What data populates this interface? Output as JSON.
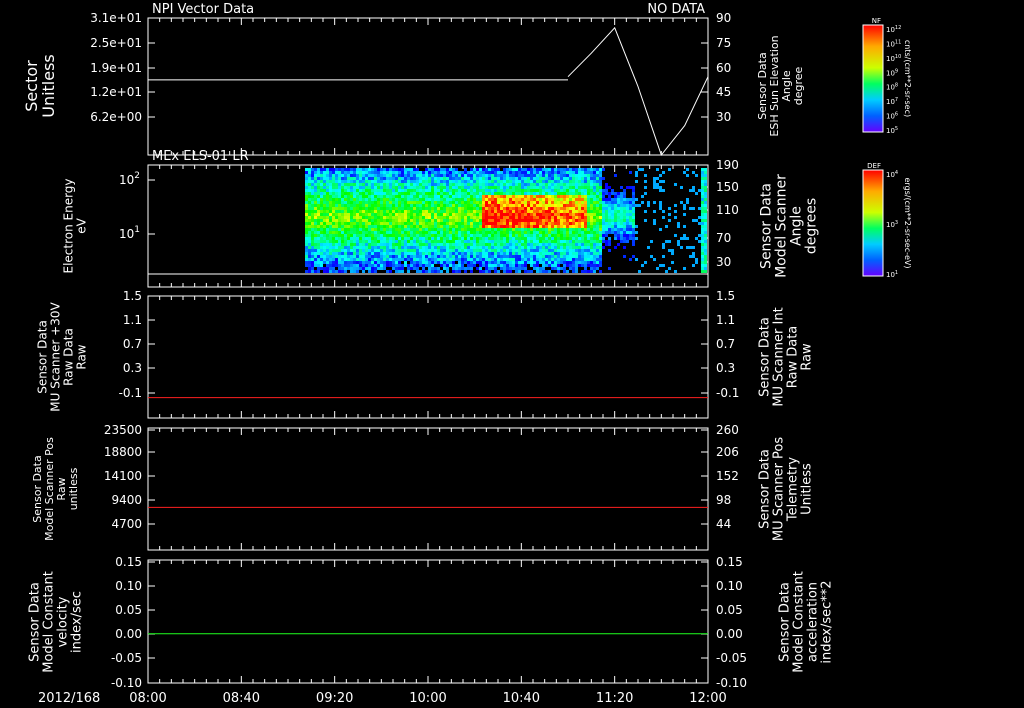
{
  "header": {
    "dataset_title": "NPI Vector Data",
    "status": "NO DATA"
  },
  "time_axis": {
    "date": "2012/168",
    "ticks": [
      "08:00",
      "08:40",
      "09:20",
      "10:00",
      "10:40",
      "11:20",
      "12:00"
    ]
  },
  "panels": [
    {
      "left_label": [
        "Sector",
        "Unitless"
      ],
      "left_ticks": [
        "3.1e+01",
        "2.5e+01",
        "1.9e+01",
        "1.2e+01",
        "6.2e+00"
      ],
      "right_label": [
        "Sensor Data",
        "ESH Sun Elevation",
        "Angle",
        "degree"
      ],
      "right_ticks": [
        "90",
        "75",
        "60",
        "45",
        "30"
      ]
    },
    {
      "title": "MEx ELS-01 LR",
      "left_label": [
        "Electron Energy",
        "eV"
      ],
      "left_ticks": [
        "10",
        "10"
      ],
      "left_tick_exponents": [
        "2",
        "1"
      ],
      "right_label": [
        "Sensor Data",
        "Model Scanner",
        "Angle",
        "degrees"
      ],
      "right_ticks": [
        "190",
        "150",
        "110",
        "70",
        "30"
      ]
    },
    {
      "left_label": [
        "Sensor Data",
        "MU Scanner +30V",
        "Raw Data",
        "Raw"
      ],
      "left_ticks": [
        "1.5",
        "1.1",
        "0.7",
        "0.3",
        "-0.1"
      ],
      "right_label": [
        "Sensor Data",
        "MU Scanner Int",
        "Raw Data",
        "Raw"
      ],
      "right_ticks": [
        "1.5",
        "1.1",
        "0.7",
        "0.3",
        "-0.1"
      ]
    },
    {
      "left_label": [
        "Sensor Data",
        "Model Scanner Pos",
        "Raw",
        "unitless"
      ],
      "left_ticks": [
        "23500",
        "18800",
        "14100",
        "9400",
        "4700"
      ],
      "right_label": [
        "Sensor Data",
        "MU Scanner Pos",
        "Telemetry",
        "Unitless"
      ],
      "right_ticks": [
        "260",
        "206",
        "152",
        "98",
        "44"
      ]
    },
    {
      "left_label": [
        "Sensor Data",
        "Model Constant",
        "velocity",
        "index/sec"
      ],
      "left_ticks": [
        "0.15",
        "0.10",
        "0.05",
        "0.00",
        "-0.05",
        "-0.10"
      ],
      "right_label": [
        "Sensor Data",
        "Model Constant",
        "acceleration",
        "index/sec**2"
      ],
      "right_ticks": [
        "0.15",
        "0.10",
        "0.05",
        "0.00",
        "-0.05",
        "-0.10"
      ]
    }
  ],
  "colorbars": [
    {
      "title": "NF",
      "unit": "cnts/(cm**2-sr-sec)",
      "ticks": [
        "10",
        "10",
        "10",
        "10",
        "10",
        "10",
        "10",
        "10"
      ],
      "exponents": [
        "12",
        "11",
        "10",
        "9",
        "8",
        "7",
        "6",
        "5"
      ]
    },
    {
      "title": "DEF",
      "unit": "ergs/(cm**2-sr-sec-eV)",
      "ticks": [
        "10",
        "10",
        "10"
      ],
      "exponents": [
        "4",
        "3",
        "1"
      ]
    }
  ],
  "colors": {
    "line_white": "#ffffff",
    "line_red": "#ff2020",
    "line_green": "#20ff20",
    "frame": "#ffffff",
    "label_red": "#ff2020",
    "label_green": "#20ff20"
  },
  "chart_data": [
    {
      "type": "line",
      "series": [
        {
          "x": [
            "08:00",
            "11:00",
            "11:10",
            "11:20",
            "11:30",
            "11:40",
            "11:50",
            "12:00"
          ],
          "values": [
            17,
            17,
            17,
            31,
            20,
            12,
            14,
            20
          ]
        },
        {
          "x": [
            "11:00",
            "11:10",
            "11:20",
            "11:30",
            "11:40",
            "11:50",
            "12:00"
          ],
          "values": [
            60,
            72,
            85,
            55,
            20,
            35,
            60
          ]
        }
      ],
      "ylim": [
        0,
        31
      ],
      "ylim_right": [
        20,
        90
      ]
    },
    {
      "type": "heatmap",
      "x_range": [
        "09:00",
        "12:00"
      ],
      "features": {
        "enhanced_flux_start": "10:23",
        "enhanced_flux_end": "11:07"
      },
      "ylim": [
        2,
        150
      ],
      "log_y": true
    },
    {
      "type": "line",
      "series": [
        {
          "x": [
            "08:00",
            "12:00"
          ],
          "values": [
            0.0,
            0.0
          ]
        }
      ],
      "ylim": [
        -0.3,
        1.5
      ]
    },
    {
      "type": "line",
      "series": [
        {
          "x": [
            "08:00",
            "12:00"
          ],
          "values": [
            8200,
            8200
          ]
        }
      ],
      "ylim": [
        0,
        23500
      ]
    },
    {
      "type": "line",
      "series": [
        {
          "x": [
            "08:00",
            "12:00"
          ],
          "values": [
            0.0,
            0.0
          ]
        }
      ],
      "ylim": [
        -0.1,
        0.15
      ]
    }
  ]
}
